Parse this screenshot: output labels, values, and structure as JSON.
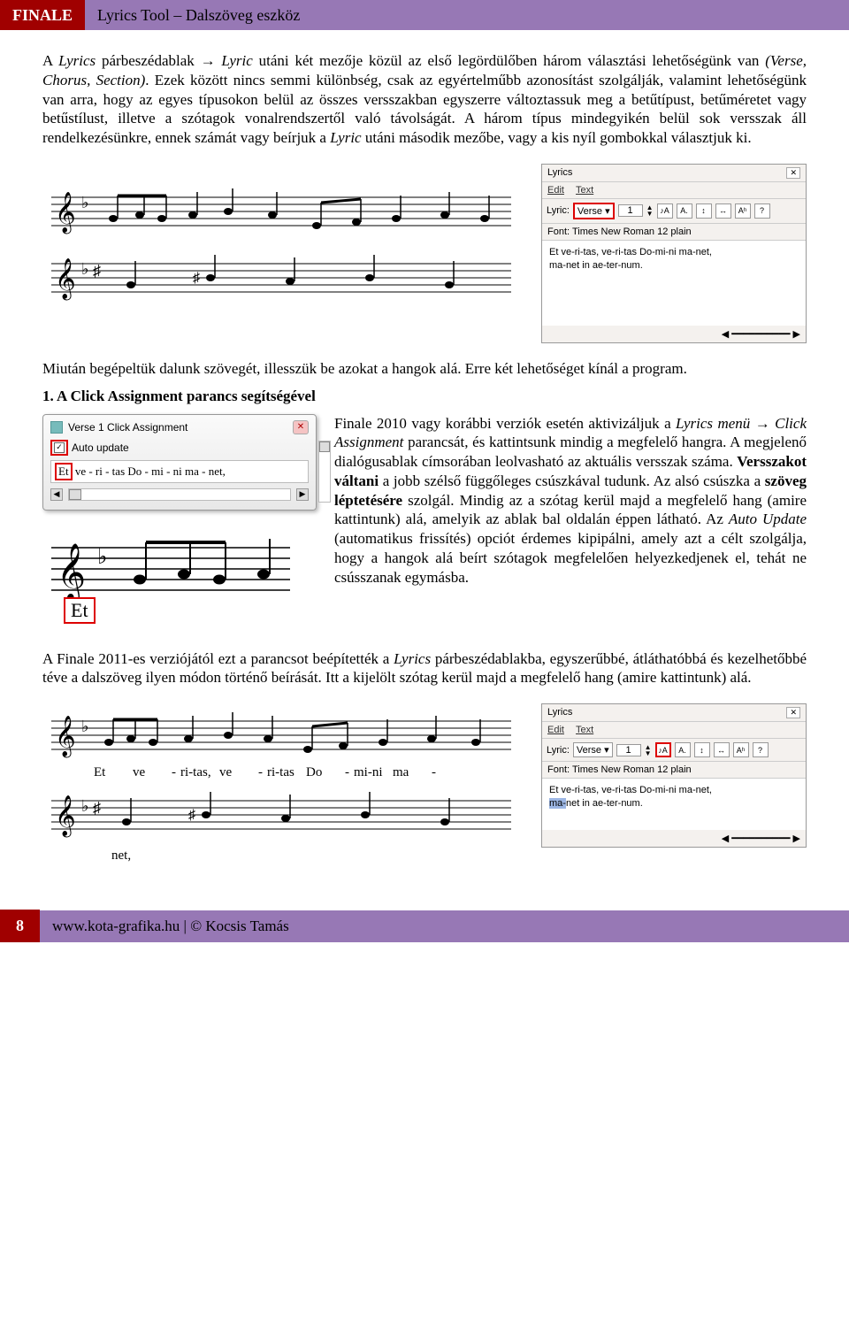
{
  "header": {
    "left": "FINALE",
    "right": "Lyrics Tool – Dalszöveg eszköz"
  },
  "p1_prefix": "A ",
  "p1_i1": "Lyrics",
  "p1_mid1": " párbeszédablak → ",
  "p1_i2": "Lyric",
  "p1_mid2": " utáni két mezője közül az első legördülőben három választási lehetőségünk van ",
  "p1_i3": "(Verse, Chorus, Section)",
  "p1_mid3": ". Ezek között nincs semmi különbség, csak az egyértelműbb azonosítást szolgálják, valamint lehetőségünk van arra, hogy az egyes típusokon belül az összes versszakban egyszerre változtassuk meg a betűtípust, betűméretet vagy betűstílust, illetve a szótagok vonalrendszertől való távolságát. A három típus mindegyikén belül sok versszak áll rendelkezésünkre, ennek számát vagy beírjuk a ",
  "p1_i4": "Lyric",
  "p1_suffix": " utáni második mezőbe, vagy a kis nyíl gombokkal választjuk ki.",
  "lyrics_win": {
    "title": "Lyrics",
    "menu1": "Edit",
    "menu2": "Text",
    "lyric_label": "Lyric:",
    "type": "Verse",
    "num": "1",
    "font_label": "Font:",
    "font_value": "Times New Roman 12 plain",
    "body_l1": "Et ve-ri-tas, ve-ri-tas Do-mi-ni ma-net,",
    "body_l2": "ma-net in ae-ter-num.",
    "sel_frag": "ma-",
    "after_frag": "net in ae-ter-num."
  },
  "p2": "Miután begépeltük dalunk szövegét, illesszük be azokat a hangok alá. Erre két lehetőséget kínál a program.",
  "h3": "1. A Click Assignment parancs segítségével",
  "click_win": {
    "title": "Verse 1 Click Assignment",
    "auto": "Auto update",
    "line": "Et ve - ri - tas Do - mi - ni ma - net,",
    "et_label": "Et"
  },
  "p3_a": "Finale 2010 vagy korábbi verziók esetén aktivizáljuk a ",
  "p3_i1": "Lyrics menü",
  "p3_arrow": " → ",
  "p3_i2": "Click Assignment",
  "p3_b": " parancsát, és kattintsunk mindig a megfelelő hangra. A megjelenő dialógusablak címsorában leolvasható az aktuális versszak száma. ",
  "p3_bold1": "Versszakot váltani",
  "p3_c": " a jobb szélső függőleges csúszkával tudunk. Az alsó csúszka a ",
  "p3_bold2": "szöveg léptetésére",
  "p3_d": " szolgál. Mindig az a szótag kerül majd a megfelelő hang (amire kattintunk) alá, amelyik az ablak bal oldalán éppen látható. Az ",
  "p3_i3": "Auto Update",
  "p3_e": " (automatikus frissítés) opciót érdemes kipipálni, amely azt a célt szolgálja, hogy a hangok alá beírt szótagok megfelelően helyezkedjenek el, tehát ne csússzanak egymásba.",
  "p4_a": "A Finale 2011-es verziójától ezt a parancsot beépítették a ",
  "p4_i1": "Lyrics",
  "p4_b": " párbeszédablakba, egyszerűbbé, átláthatóbbá és kezelhetőbbé téve a dalszöveg ilyen módon történő beírását. Itt a kijelölt szótag kerül majd a megfelelő hang (amire kattintunk) alá.",
  "bottom_lyrics": {
    "l1": [
      "Et",
      "ve",
      "-",
      "ri-tas,",
      "ve",
      "-",
      "ri-tas",
      "Do",
      "-",
      "mi-ni",
      "ma",
      "-"
    ],
    "l2": "net,"
  },
  "footer": {
    "page": "8",
    "text": "www.kota-grafika.hu | © Kocsis Tamás"
  }
}
